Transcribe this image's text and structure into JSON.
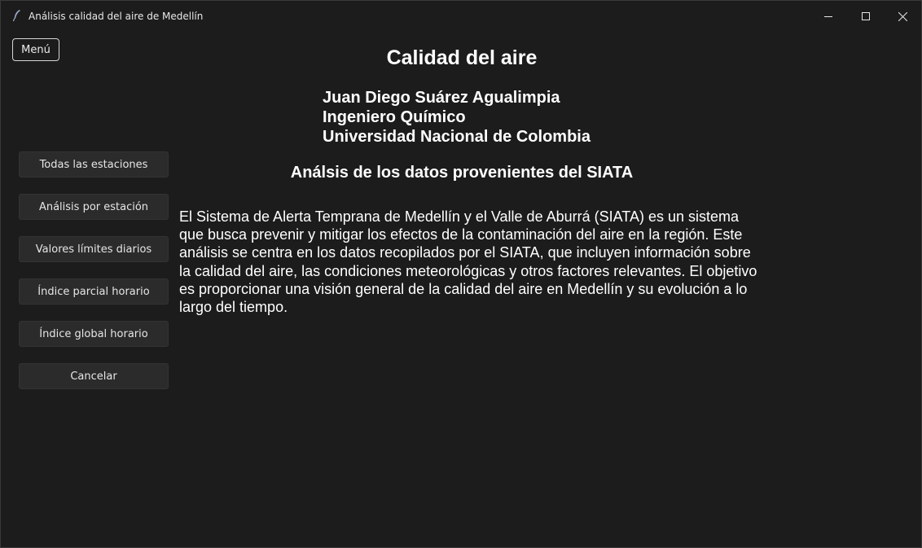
{
  "window": {
    "title": "Análisis calidad del aire de Medellín",
    "icon": "feather-icon"
  },
  "menu": {
    "label": "Menú"
  },
  "sidebar": {
    "buttons": [
      {
        "label": "Todas las estaciones"
      },
      {
        "label": "Análisis por estación"
      },
      {
        "label": "Valores límites diarios"
      },
      {
        "label": "Índice parcial horario"
      },
      {
        "label": "Índice global horario"
      },
      {
        "label": "Cancelar"
      }
    ]
  },
  "main": {
    "title": "Calidad del aire",
    "author": {
      "name": "Juan Diego Suárez Agualimpia",
      "profession": "Ingeniero Químico",
      "university": "Universidad Nacional de Colombia"
    },
    "section_title": "Análsis de los datos provenientes del SIATA",
    "description": "El Sistema de Alerta Temprana de Medellín y el Valle de Aburrá (SIATA) es un sistema que busca prevenir y mitigar los efectos de la contaminación del aire en la región. Este análisis se centra en los datos recopilados por el SIATA, que incluyen información sobre la calidad del aire, las condiciones meteorológicas y otros factores relevantes. El objetivo es proporcionar una visión general de la calidad del aire en Medellín y su evolución a lo largo del tiempo."
  },
  "colors": {
    "background": "#1c1c1c",
    "button_bg": "#2b2b2b",
    "text": "#ffffff"
  }
}
